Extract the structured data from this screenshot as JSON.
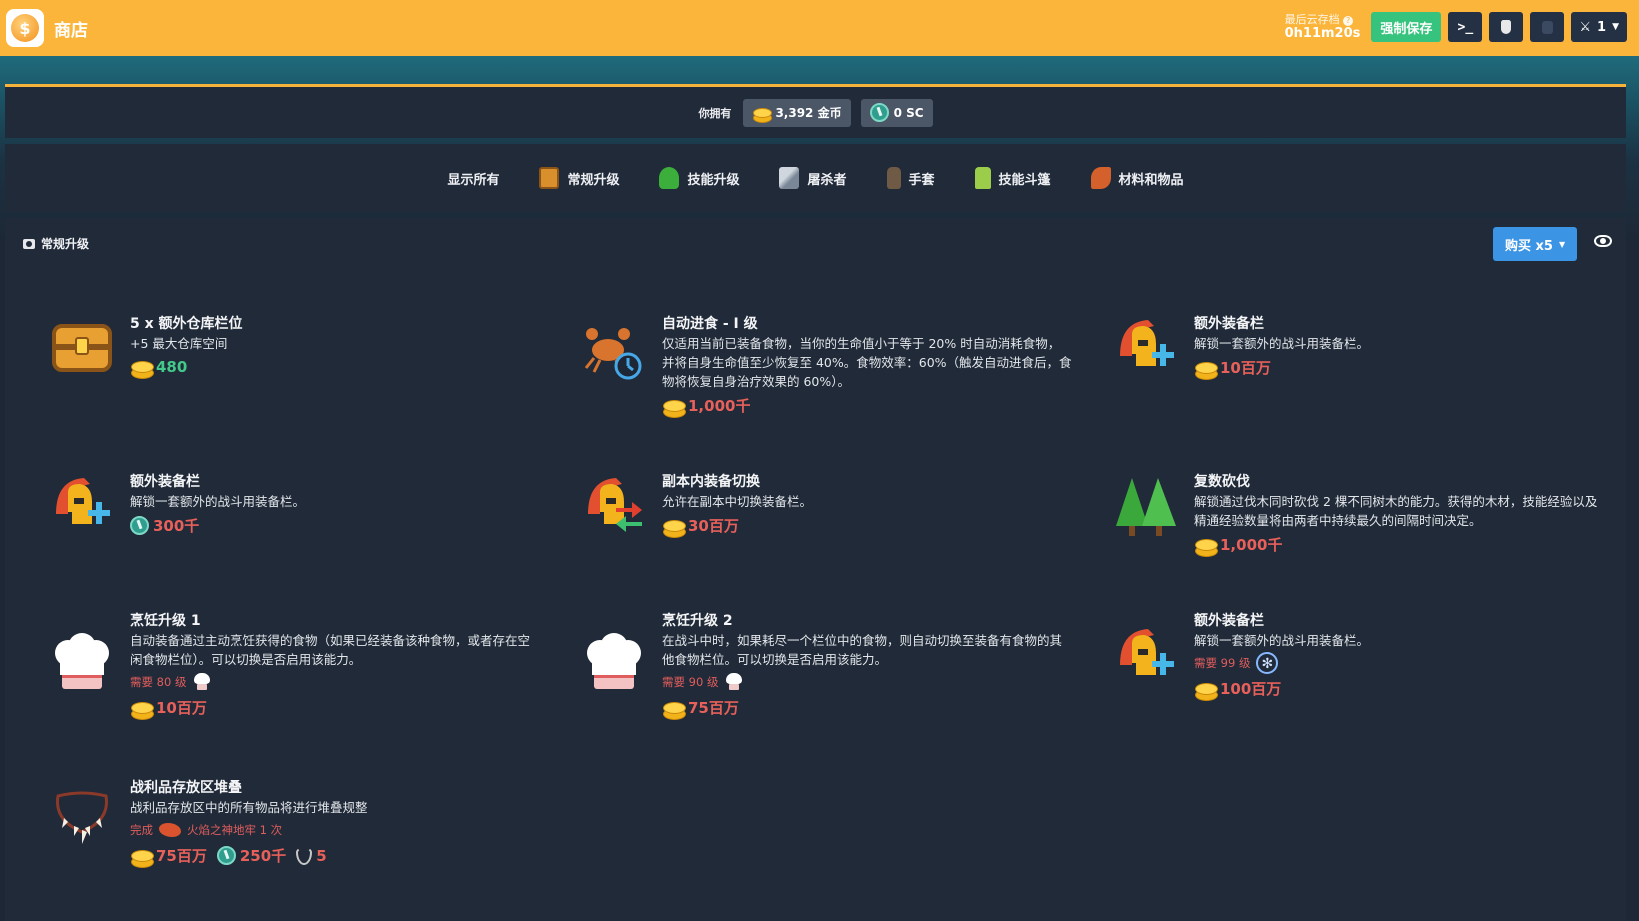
{
  "header": {
    "title": "商店",
    "save_label": "最后云存档",
    "save_time": "0h11m20s",
    "force_save": "强制保存",
    "loadout_count": "1"
  },
  "currency": {
    "own_label": "你拥有",
    "gold": "3,392 金币",
    "sc": "0 SC"
  },
  "tabs": [
    {
      "label": "显示所有",
      "icon": "none"
    },
    {
      "label": "常规升级",
      "icon": "chest-icon"
    },
    {
      "label": "技能升级",
      "icon": "tree-icon"
    },
    {
      "label": "屠杀者",
      "icon": "slayer-icon"
    },
    {
      "label": "手套",
      "icon": "glove-icon"
    },
    {
      "label": "技能斗篷",
      "icon": "cape-icon"
    },
    {
      "label": "材料和物品",
      "icon": "leaf-icon"
    }
  ],
  "section": {
    "title": "常规升级",
    "buy_button": "购买 x5"
  },
  "items": [
    {
      "name": "5 x 额外仓库栏位",
      "desc": "+5 最大仓库空间",
      "price": "480",
      "price_color": "#43c98a",
      "icon": "chest-icon"
    },
    {
      "name": "自动进食 - I 级",
      "desc": "仅适用当前已装备食物，当你的生命值小于等于 20% 时自动消耗食物，并将自身生命值至少恢复至 40%。食物效率：60%（触发自动进食后，食物将恢复自身治疗效果的 60%）。",
      "price": "1,000千",
      "icon": "crab-timer-icon"
    },
    {
      "name": "额外装备栏",
      "desc": "解锁一套额外的战斗用装备栏。",
      "price": "10百万",
      "icon": "helmet-plus-icon"
    },
    {
      "name": "额外装备栏",
      "desc": "解锁一套额外的战斗用装备栏。",
      "price": "300千",
      "currency": "sc",
      "icon": "helmet-plus-icon"
    },
    {
      "name": "副本内装备切换",
      "desc": "允许在副本中切换装备栏。",
      "price": "30百万",
      "icon": "helmet-swap-icon"
    },
    {
      "name": "复数砍伐",
      "desc": "解锁通过伐木同时砍伐 2 棵不同树木的能力。获得的木材，技能经验以及精通经验数量将由两者中持续最久的间隔时间决定。",
      "price": "1,000千",
      "icon": "trees-icon"
    },
    {
      "name": "烹饪升级 1",
      "desc": "自动装备通过主动烹饪获得的食物（如果已经装备该种食物，或者存在空闲食物栏位）。可以切换是否启用该能力。",
      "req": "需要 80 级",
      "price": "10百万",
      "icon": "chef-hat-icon"
    },
    {
      "name": "烹饪升级 2",
      "desc": "在战斗中时，如果耗尽一个栏位中的食物，则自动切换至装备有食物的其他食物栏位。可以切换是否启用该能力。",
      "req": "需要 90 级",
      "price": "75百万",
      "icon": "chef-hat-icon"
    },
    {
      "name": "额外装备栏",
      "desc": "解锁一套额外的战斗用装备栏。",
      "req": "需要 99 级",
      "price": "100百万",
      "icon": "helmet-plus-icon"
    },
    {
      "name": "战利品存放区堆叠",
      "desc": "战利品存放区中的所有物品将进行堆叠规整",
      "req": "完成",
      "req_target": "火焰之神地牢 1 次",
      "price": "75百万",
      "price2": "250千",
      "price3": "5",
      "icon": "necklace-icon"
    }
  ],
  "colors": {
    "header": "#fbb53a",
    "panel": "#202a38",
    "price_red": "#e8605a",
    "price_green": "#43c98a",
    "accent_blue": "#3c94e4",
    "save_green": "#35c37d"
  }
}
